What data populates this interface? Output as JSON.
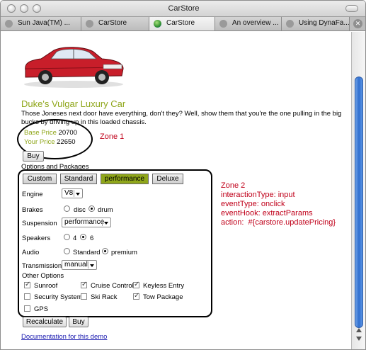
{
  "window": {
    "title": "CarStore"
  },
  "tabs": [
    {
      "label": "Sun Java(TM) ...",
      "active": false,
      "icon": "close-icon"
    },
    {
      "label": "CarStore",
      "active": false,
      "icon": "close-icon"
    },
    {
      "label": "CarStore",
      "active": true,
      "icon": "globe-icon"
    },
    {
      "label": "An overview ...",
      "active": false,
      "icon": "close-icon"
    },
    {
      "label": "Using DynaFa...",
      "active": false,
      "icon": "close-icon"
    }
  ],
  "car": {
    "name": "Duke's Vulgar Luxury Car",
    "description": "Those Joneses next door have everything, don't they? Well, show them that you're the one pulling in the big bucks by driving up in this loaded chassis.",
    "base_price_label": "Base Price",
    "base_price": "20700",
    "your_price_label": "Your Price",
    "your_price": "22650",
    "color": "#c81e2a"
  },
  "buy_label": "Buy",
  "options_heading": "Options and Packages",
  "packages": [
    {
      "label": "Custom",
      "selected": false
    },
    {
      "label": "Standard",
      "selected": false
    },
    {
      "label": "performance",
      "selected": true
    },
    {
      "label": "Deluxe",
      "selected": false
    }
  ],
  "form": {
    "engine": {
      "label": "Engine",
      "value": "V8"
    },
    "brakes": {
      "label": "Brakes",
      "options": [
        "disc",
        "drum"
      ],
      "selected": "drum"
    },
    "suspension": {
      "label": "Suspension",
      "value": "performance"
    },
    "speakers": {
      "label": "Speakers",
      "options": [
        "4",
        "6"
      ],
      "selected": "6"
    },
    "audio": {
      "label": "Audio",
      "options": [
        "Standard",
        "premium"
      ],
      "selected": "premium"
    },
    "transmission": {
      "label": "Transmission",
      "value": "manual"
    }
  },
  "other_options": {
    "heading": "Other Options",
    "items": [
      {
        "label": "Sunroof",
        "checked": true
      },
      {
        "label": "Cruise Control",
        "checked": true
      },
      {
        "label": "Keyless Entry",
        "checked": true
      },
      {
        "label": "Security System",
        "checked": false
      },
      {
        "label": "Ski Rack",
        "checked": false
      },
      {
        "label": "Tow Package",
        "checked": true
      },
      {
        "label": "GPS",
        "checked": false
      }
    ]
  },
  "actions": {
    "recalculate": "Recalculate",
    "buy": "Buy"
  },
  "doc_link": "Documentation for this demo",
  "annotations": {
    "zone1": "Zone 1",
    "zone2": "Zone 2\ninteractionType: input\neventType: onclick\neventHook: extractParams\naction:  #{carstore.updatePricing}",
    "color": "#c0001a"
  },
  "colors": {
    "accent": "#8fa61a",
    "selected_package": "#8fa61a",
    "scrollbar": "#2f6fd0"
  }
}
